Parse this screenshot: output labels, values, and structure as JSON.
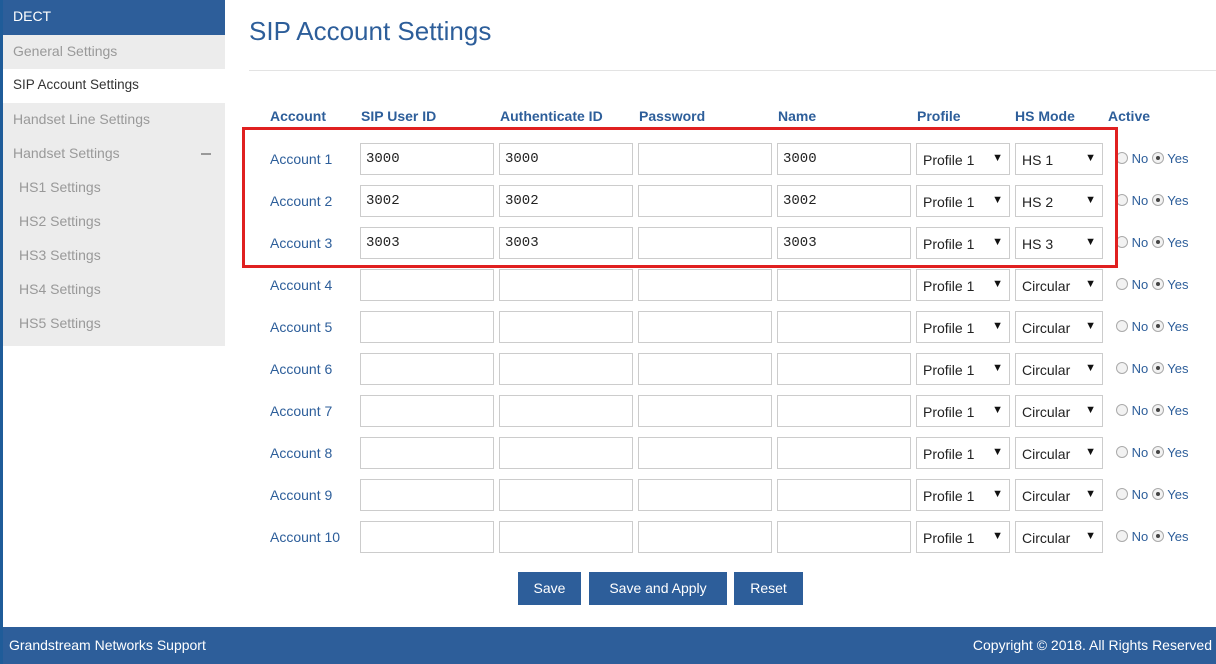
{
  "sidebar": {
    "header": "DECT",
    "items": [
      "General Settings",
      "SIP Account Settings",
      "Handset Line Settings",
      "Handset Settings",
      "HS1 Settings",
      "HS2 Settings",
      "HS3 Settings",
      "HS4 Settings",
      "HS5 Settings"
    ],
    "active_item": "SIP Account Settings"
  },
  "page": {
    "title": "SIP Account Settings"
  },
  "table": {
    "columns": [
      "Account",
      "SIP User ID",
      "Authenticate ID",
      "Password",
      "Name",
      "Profile",
      "HS Mode",
      "Active"
    ],
    "rows": [
      {
        "account": "Account 1",
        "sip_user_id": "3000",
        "auth_id": "3000",
        "password": "",
        "name": "3000",
        "profile": "Profile 1",
        "hs_mode": "HS 1",
        "no_label": "No",
        "yes_label": "Yes",
        "active": "Yes"
      },
      {
        "account": "Account 2",
        "sip_user_id": "3002",
        "auth_id": "3002",
        "password": "",
        "name": "3002",
        "profile": "Profile 1",
        "hs_mode": "HS 2",
        "no_label": "No",
        "yes_label": "Yes",
        "active": "Yes"
      },
      {
        "account": "Account 3",
        "sip_user_id": "3003",
        "auth_id": "3003",
        "password": "",
        "name": "3003",
        "profile": "Profile 1",
        "hs_mode": "HS 3",
        "no_label": "No",
        "yes_label": "Yes",
        "active": "Yes"
      },
      {
        "account": "Account 4",
        "sip_user_id": "",
        "auth_id": "",
        "password": "",
        "name": "",
        "profile": "Profile 1",
        "hs_mode": "Circular",
        "no_label": "No",
        "yes_label": "Yes",
        "active": "Yes"
      },
      {
        "account": "Account 5",
        "sip_user_id": "",
        "auth_id": "",
        "password": "",
        "name": "",
        "profile": "Profile 1",
        "hs_mode": "Circular",
        "no_label": "No",
        "yes_label": "Yes",
        "active": "Yes"
      },
      {
        "account": "Account 6",
        "sip_user_id": "",
        "auth_id": "",
        "password": "",
        "name": "",
        "profile": "Profile 1",
        "hs_mode": "Circular",
        "no_label": "No",
        "yes_label": "Yes",
        "active": "Yes"
      },
      {
        "account": "Account 7",
        "sip_user_id": "",
        "auth_id": "",
        "password": "",
        "name": "",
        "profile": "Profile 1",
        "hs_mode": "Circular",
        "no_label": "No",
        "yes_label": "Yes",
        "active": "Yes"
      },
      {
        "account": "Account 8",
        "sip_user_id": "",
        "auth_id": "",
        "password": "",
        "name": "",
        "profile": "Profile 1",
        "hs_mode": "Circular",
        "no_label": "No",
        "yes_label": "Yes",
        "active": "Yes"
      },
      {
        "account": "Account 9",
        "sip_user_id": "",
        "auth_id": "",
        "password": "",
        "name": "",
        "profile": "Profile 1",
        "hs_mode": "Circular",
        "no_label": "No",
        "yes_label": "Yes",
        "active": "Yes"
      },
      {
        "account": "Account 10",
        "sip_user_id": "",
        "auth_id": "",
        "password": "",
        "name": "",
        "profile": "Profile 1",
        "hs_mode": "Circular",
        "no_label": "No",
        "yes_label": "Yes",
        "active": "Yes"
      }
    ]
  },
  "buttons": {
    "save": "Save",
    "save_apply": "Save and Apply",
    "reset": "Reset"
  },
  "footer": {
    "left": "Grandstream Networks Support",
    "right": "Copyright © 2018. All Rights Reserved"
  },
  "colors": {
    "brand_blue": "#2d5e9a",
    "highlight_red": "#e02020"
  }
}
